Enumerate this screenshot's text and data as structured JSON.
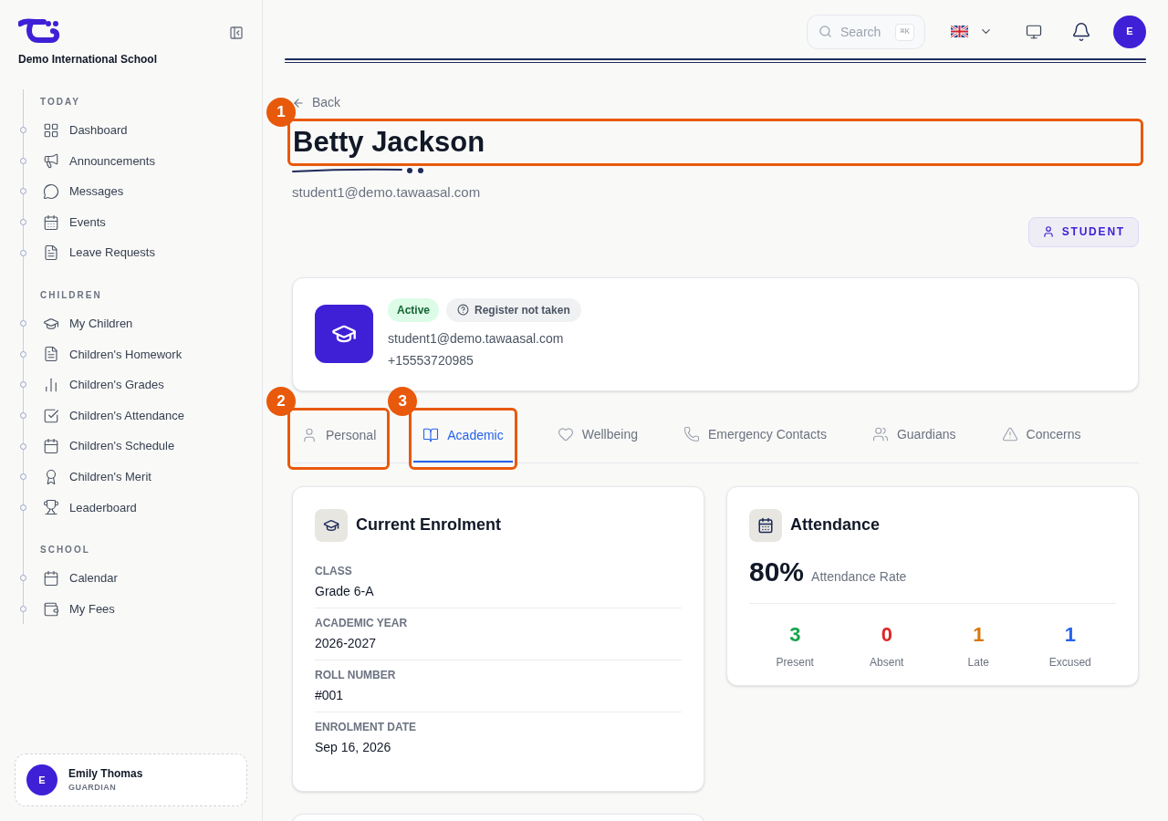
{
  "school": {
    "name": "Demo International School"
  },
  "sidebar": {
    "sections": [
      {
        "heading": "TODAY",
        "items": [
          {
            "label": "Dashboard"
          },
          {
            "label": "Announcements"
          },
          {
            "label": "Messages"
          },
          {
            "label": "Events"
          },
          {
            "label": "Leave Requests"
          }
        ]
      },
      {
        "heading": "CHILDREN",
        "items": [
          {
            "label": "My Children"
          },
          {
            "label": "Children's Homework"
          },
          {
            "label": "Children's Grades"
          },
          {
            "label": "Children's Attendance"
          },
          {
            "label": "Children's Schedule"
          },
          {
            "label": "Children's Merit"
          },
          {
            "label": "Leaderboard"
          }
        ]
      },
      {
        "heading": "SCHOOL",
        "items": [
          {
            "label": "Calendar"
          },
          {
            "label": "My Fees"
          }
        ]
      }
    ],
    "user": {
      "initial": "E",
      "name": "Emily Thomas",
      "role": "GUARDIAN"
    }
  },
  "topbar": {
    "search": {
      "placeholder": "Search",
      "shortcut": "⌘K"
    },
    "avatar": "E"
  },
  "back": "Back",
  "title": {
    "text": "Betty Jackson",
    "callout": "1"
  },
  "email": "student1@demo.tawaasal.com",
  "role_badge": "STUDENT",
  "profile": {
    "status": "Active",
    "register": "Register not taken",
    "email": "student1@demo.tawaasal.com",
    "phone": "+15553720985"
  },
  "tabs": [
    {
      "label": "Personal",
      "selected": false,
      "callout": "2"
    },
    {
      "label": "Academic",
      "selected": true,
      "callout": "3"
    },
    {
      "label": "Wellbeing",
      "selected": false
    },
    {
      "label": "Emergency Contacts",
      "selected": false
    },
    {
      "label": "Guardians",
      "selected": false
    },
    {
      "label": "Concerns",
      "selected": false
    }
  ],
  "enrolment": {
    "title": "Current Enrolment",
    "fields": [
      {
        "label": "CLASS",
        "value": "Grade 6-A"
      },
      {
        "label": "ACADEMIC YEAR",
        "value": "2026-2027"
      },
      {
        "label": "ROLL NUMBER",
        "value": "#001"
      },
      {
        "label": "ENROLMENT DATE",
        "value": "Sep 16, 2026"
      }
    ]
  },
  "attendance": {
    "title": "Attendance",
    "rate": "80%",
    "rate_label": "Attendance Rate",
    "stats": [
      {
        "value": "3",
        "label": "Present",
        "color": "#16a34a"
      },
      {
        "value": "0",
        "label": "Absent",
        "color": "#dc2626"
      },
      {
        "value": "1",
        "label": "Late",
        "color": "#d97706"
      },
      {
        "value": "1",
        "label": "Excused",
        "color": "#2563eb"
      }
    ]
  }
}
